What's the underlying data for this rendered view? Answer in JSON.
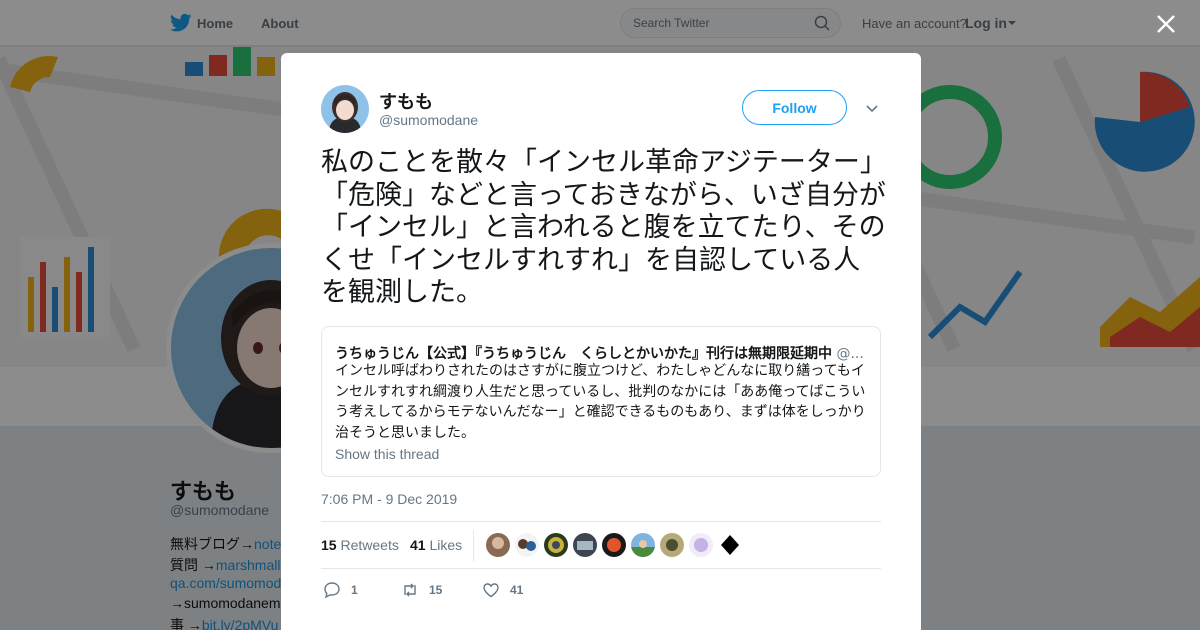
{
  "nav": {
    "home_label": "Home",
    "about_label": "About",
    "search_placeholder": "Search Twitter",
    "account_prompt": "Have an account?",
    "login_label": "Log in"
  },
  "profile": {
    "name": "すもも",
    "handle": "@sumomodane",
    "bio": [
      {
        "text": "無料ブログ→",
        "link": "note"
      },
      {
        "text": "質問 →",
        "link": "marshmall"
      },
      {
        "text": "",
        "link": "qa.com/sumomod"
      },
      {
        "text": "→sumomodanem",
        "link": ""
      },
      {
        "text": "事 →",
        "link": "bit.ly/2pMVu"
      }
    ]
  },
  "tweet": {
    "author_name": "すもも",
    "author_handle": "@sumomodane",
    "follow_label": "Follow",
    "text": "私のことを散々「インセル革命アジテーター」「危険」などと言っておきながら、いざ自分が「インセル」と言われると腹を立てたり、そのくせ「インセルすれすれ」を自認している人を観測した。",
    "timestamp": "7:06 PM - 9 Dec 2019",
    "retweets": "15",
    "retweets_label": "Retweets",
    "likes": "41",
    "likes_label": "Likes",
    "reply_count": "1",
    "retweet_count": "15",
    "like_count": "41",
    "quote": {
      "author": "うちゅうじん【公式】『うちゅうじん　くらしとかいかた』刊行は無期限延期中",
      "handle": "@...",
      "text": "インセル呼ばわりされたのはさすがに腹立つけど、わたしゃどんなに取り繕ってもインセルすれすれ綱渡り人生だと思っているし、批判のなかには「ああ俺ってばこういう考えしてるからモテないんだなー」と確認できるものもあり、まずは体をしっかり治そうと思いました。",
      "thread_label": "Show this thread"
    }
  },
  "colors": {
    "accent": "#1da1f2",
    "text": "#14171a",
    "muted": "#657786"
  }
}
